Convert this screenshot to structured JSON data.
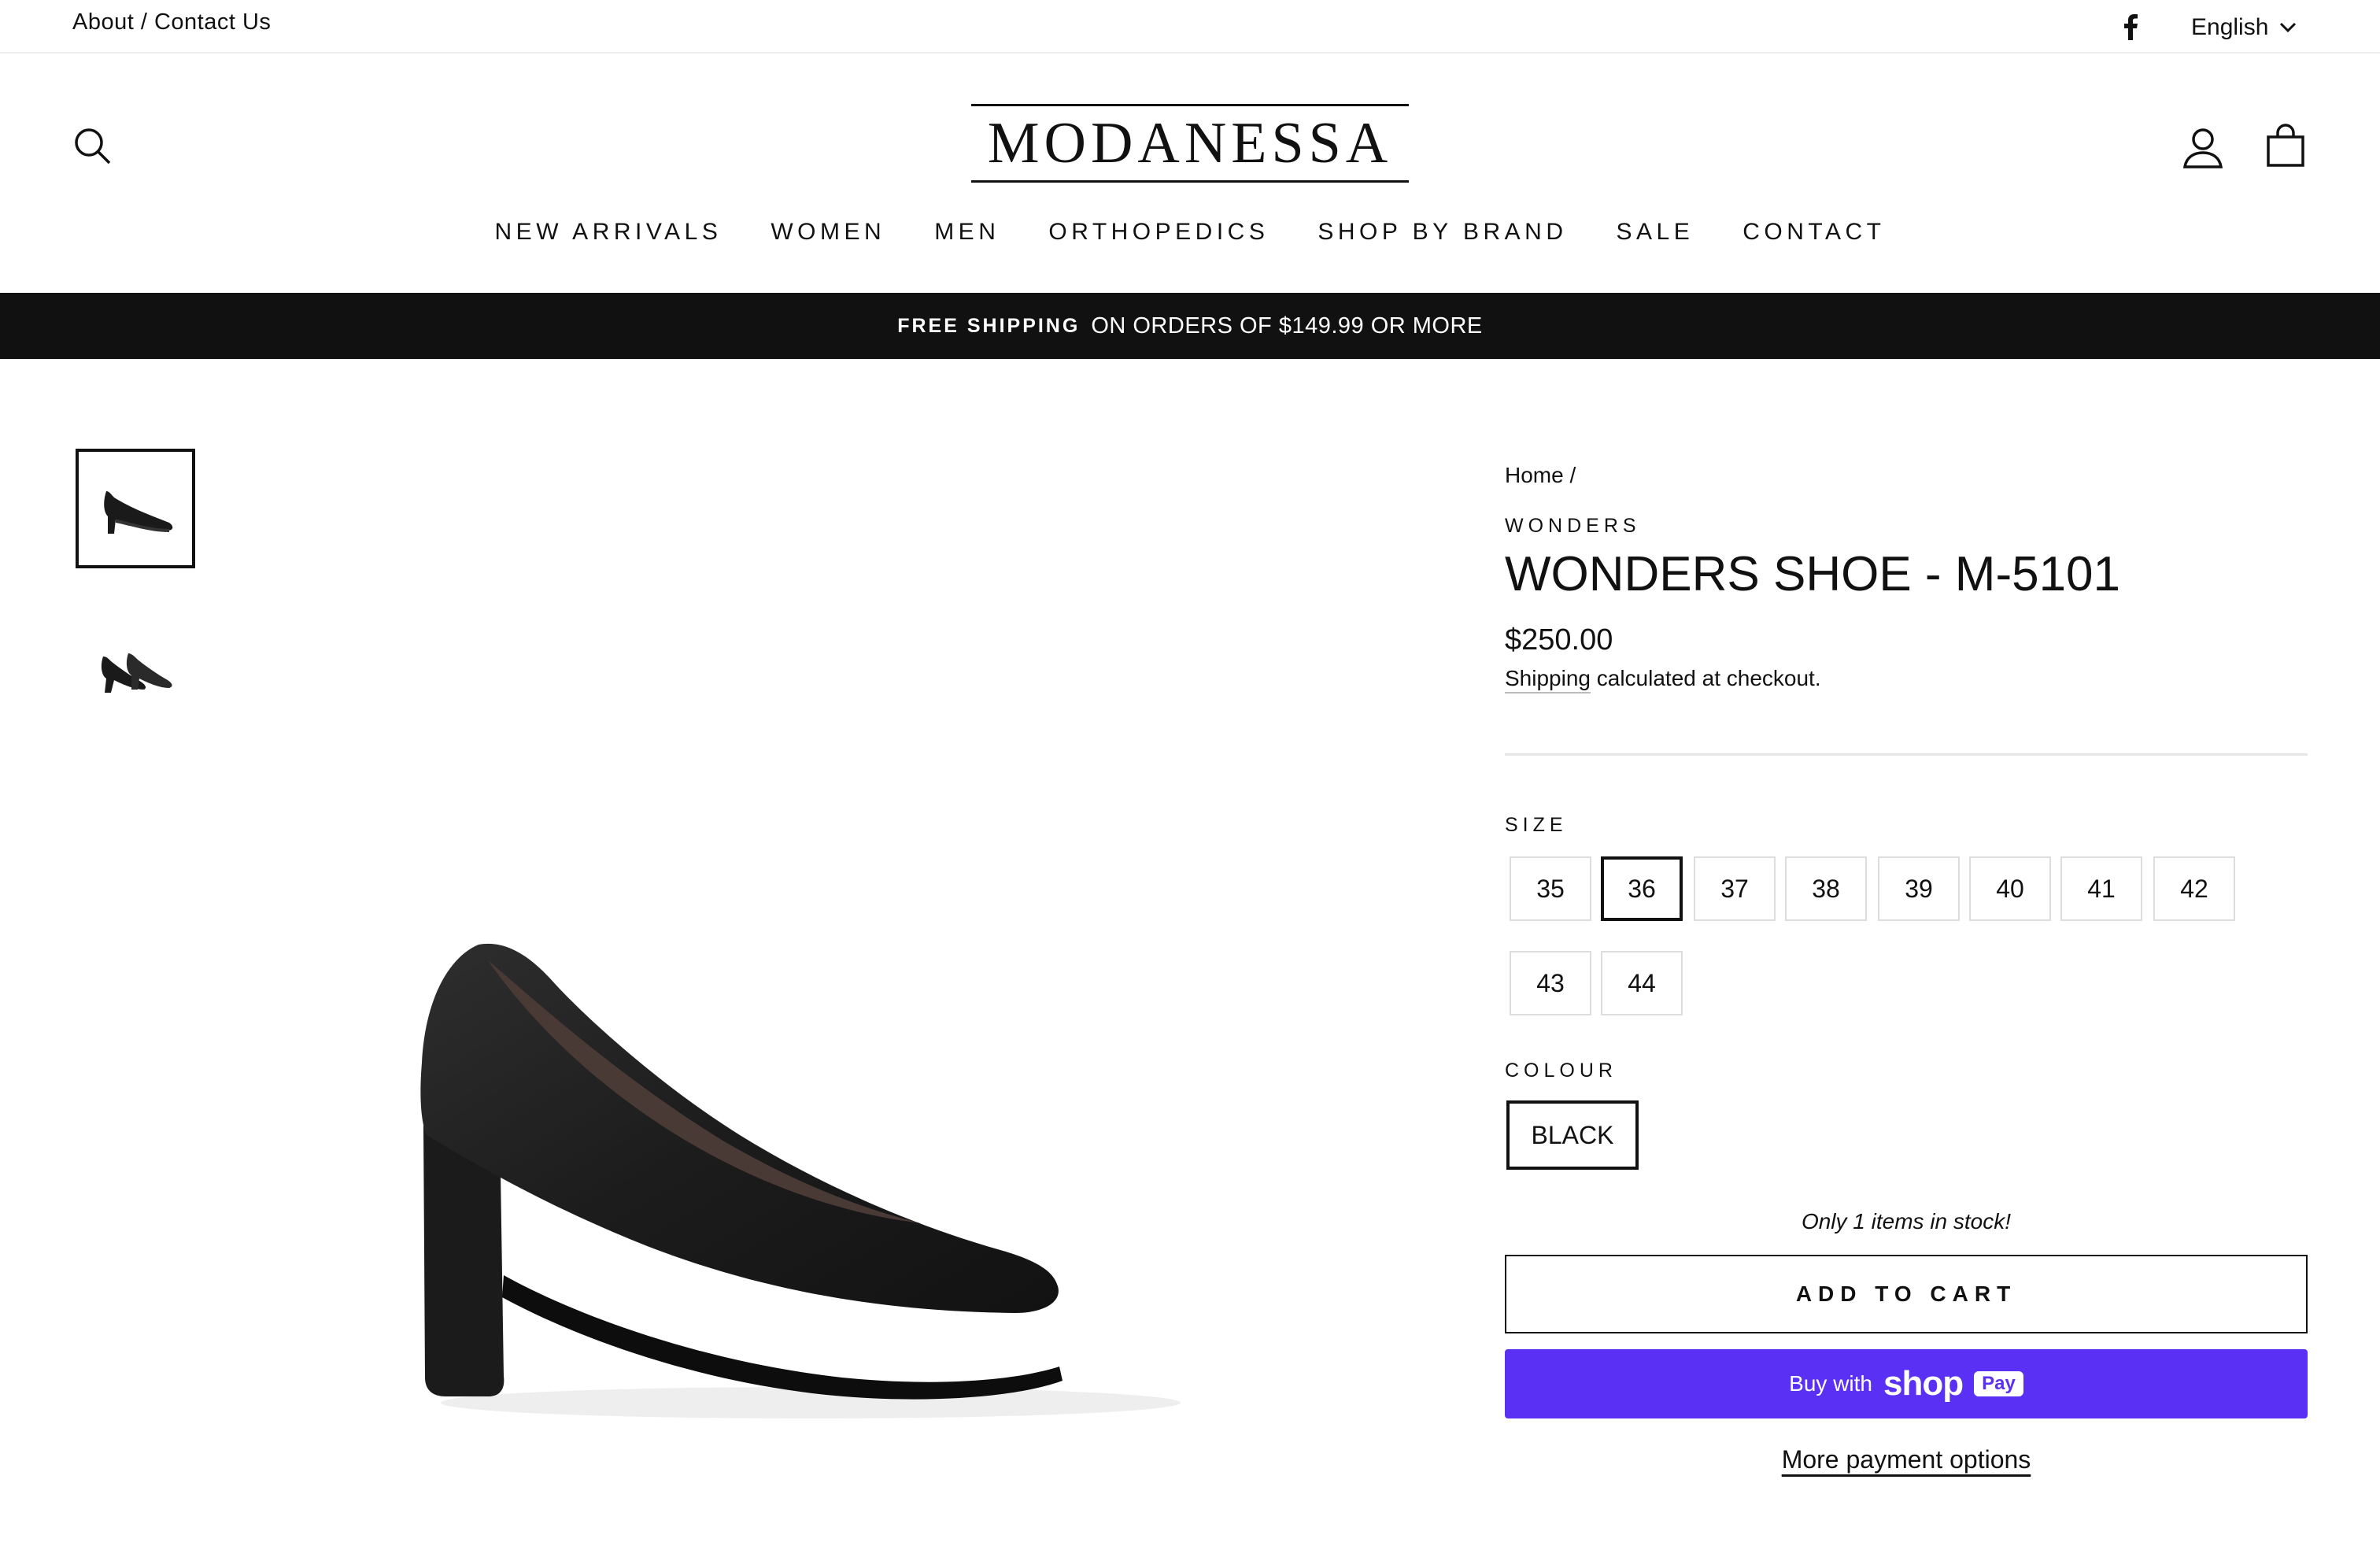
{
  "utility_bar": {
    "about_contact": "About / Contact Us",
    "social_icon": "facebook-icon",
    "language": "English",
    "language_icon": "chevron-down-icon"
  },
  "header": {
    "logo": "MODANESSA",
    "icons": {
      "search": "search-icon",
      "account": "user-icon",
      "cart": "shopping-bag-icon"
    },
    "nav": [
      "NEW ARRIVALS",
      "WOMEN",
      "MEN",
      "ORTHOPEDICS",
      "SHOP BY BRAND",
      "SALE",
      "CONTACT"
    ]
  },
  "announcement": {
    "strong": "FREE SHIPPING",
    "rest": "ON ORDERS OF $149.99 OR MORE"
  },
  "gallery": {
    "thumbnails": [
      "single-pump-side-view",
      "pair-of-pumps-view"
    ],
    "active_index": 0
  },
  "product": {
    "breadcrumb": "Home /",
    "vendor": "WONDERS",
    "title": "WONDERS SHOE - M-5101",
    "price": "$250.00",
    "shipping_link": "Shipping",
    "shipping_rest": " calculated at checkout.",
    "size_label": "SIZE",
    "sizes": [
      "35",
      "36",
      "37",
      "38",
      "39",
      "40",
      "41",
      "42",
      "43",
      "44"
    ],
    "selected_size": "36",
    "colour_label": "COLOUR",
    "colour": "BLACK",
    "stock_note": "Only 1 items in stock!",
    "add_to_cart": "ADD TO CART",
    "shop_pay": {
      "prefix": "Buy with",
      "brand": "shop",
      "pill": "Pay"
    },
    "more_payment": "More payment options"
  },
  "colors": {
    "text": "#111111",
    "announcement_bg": "#111111",
    "shop_pay": "#5a31f4",
    "border_light": "#dddddd"
  }
}
